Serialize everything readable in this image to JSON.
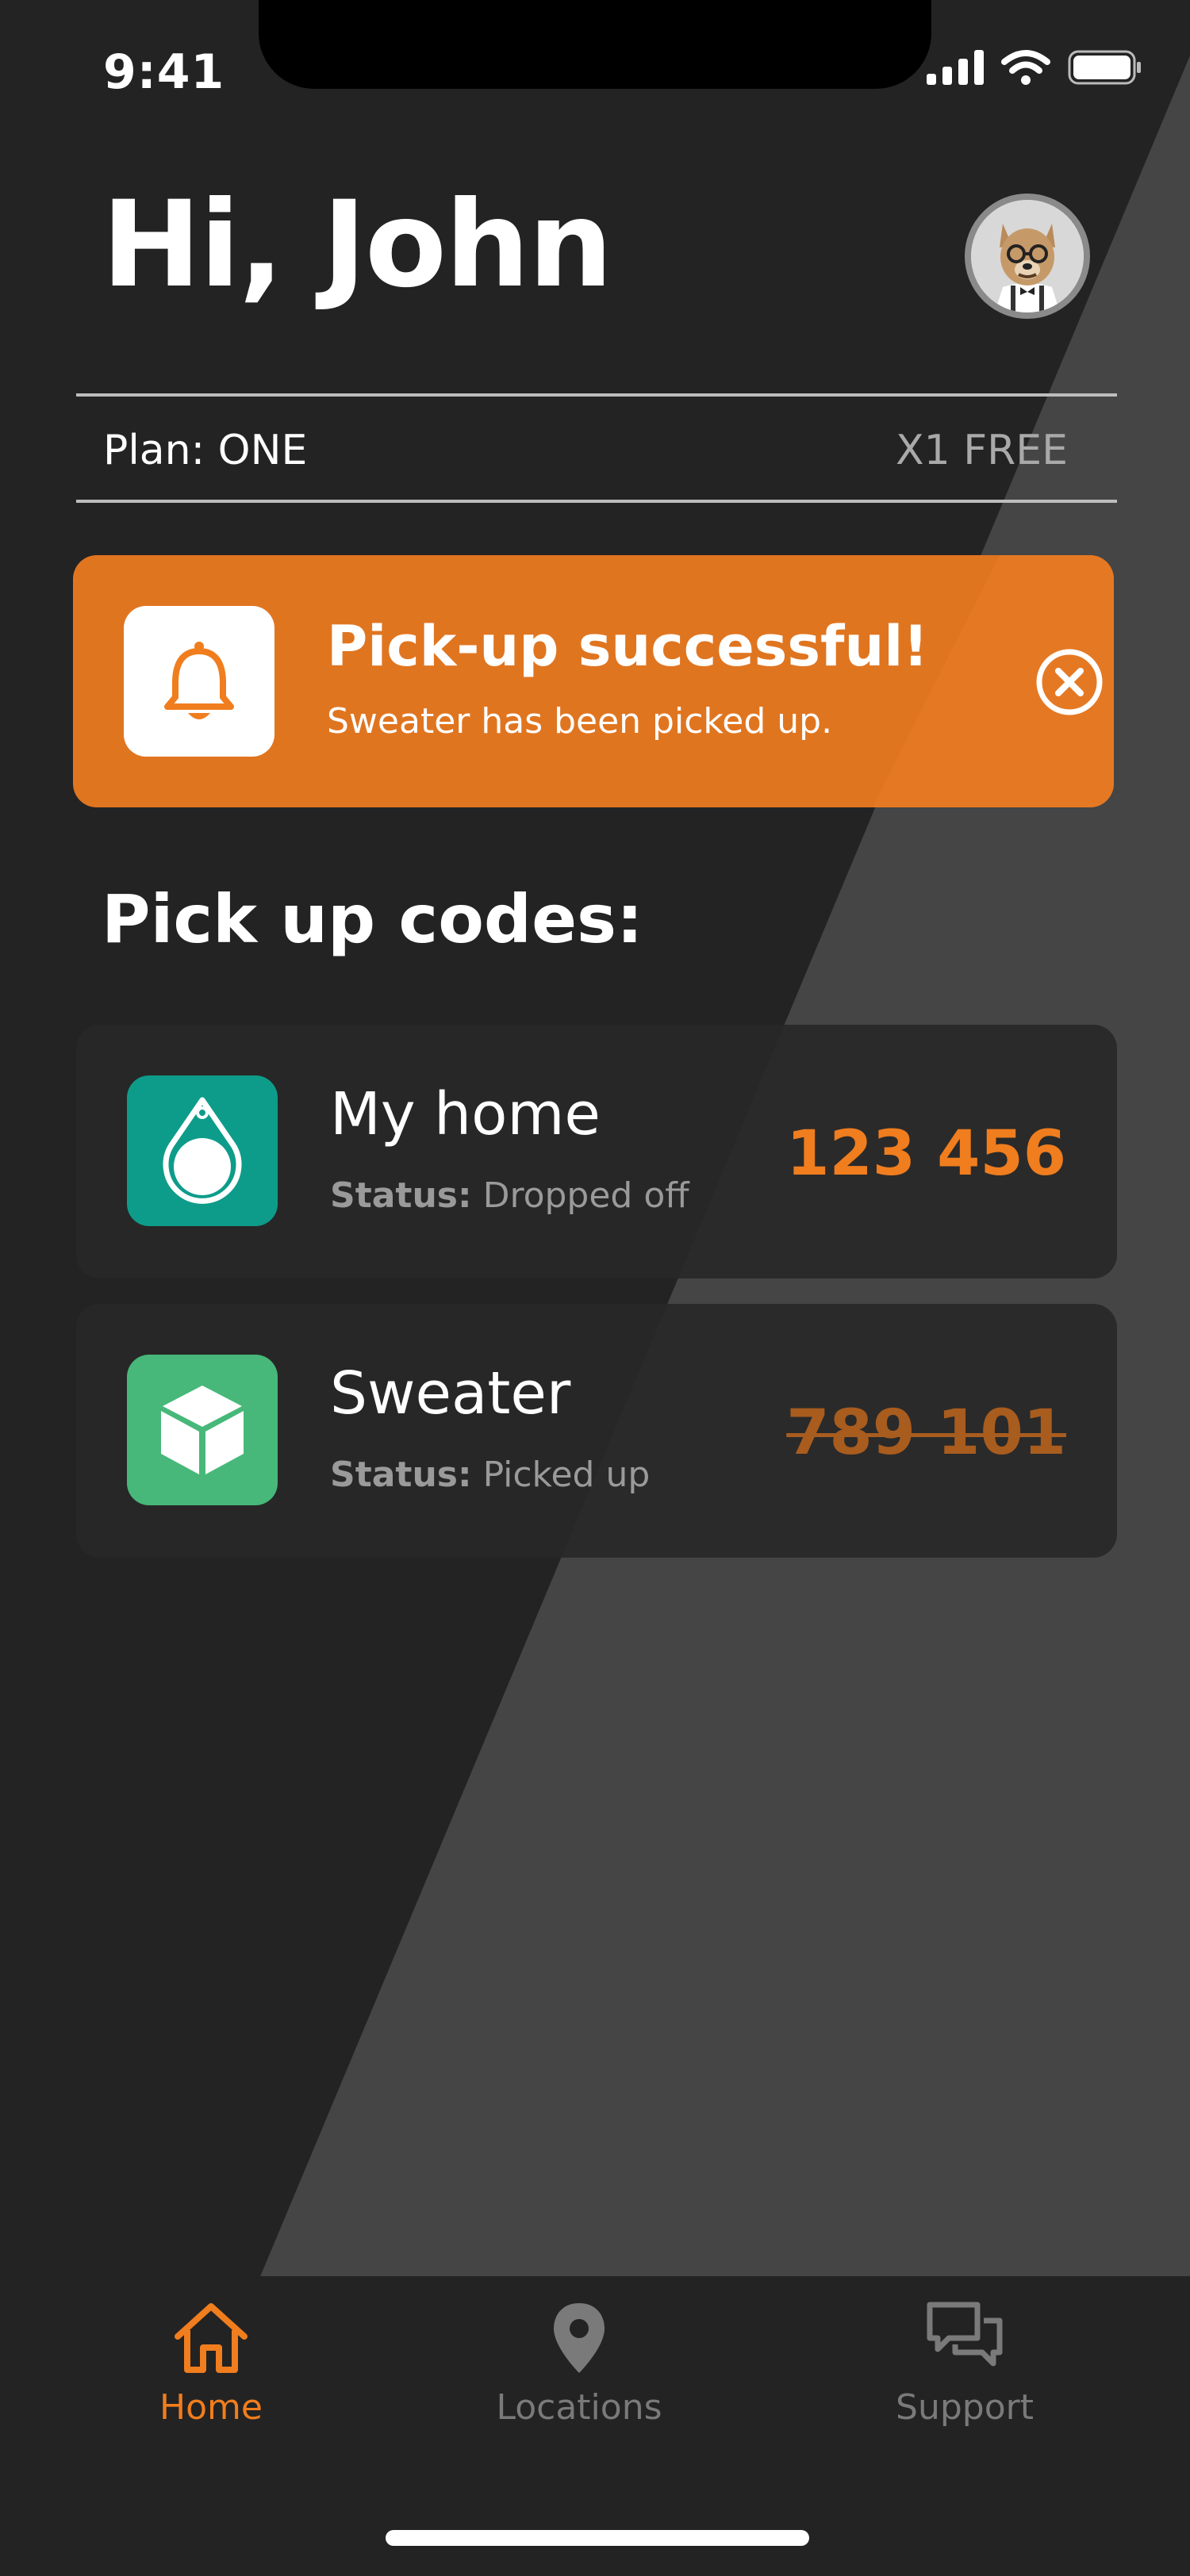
{
  "status_bar": {
    "time": "9:41"
  },
  "header": {
    "greeting": "Hi, John"
  },
  "plan": {
    "label": "Plan: ONE",
    "offer": "X1 FREE"
  },
  "alert": {
    "title": "Pick-up successful!",
    "message": "Sweater has been picked up.",
    "icon": "bell-icon"
  },
  "pickup": {
    "title": "Pick up codes:",
    "status_label": "Status:",
    "items": [
      {
        "name": "My home",
        "status": "Dropped off",
        "code": "123 456",
        "icon": "key-fob-icon",
        "color": "#0e9c8a"
      },
      {
        "name": "Sweater",
        "status": "Picked up",
        "code": "789 101",
        "icon": "box-icon",
        "color": "#47b87a"
      }
    ]
  },
  "tabs": [
    {
      "label": "Home",
      "icon": "home-icon",
      "active": true
    },
    {
      "label": "Locations",
      "icon": "location-pin-icon",
      "active": false
    },
    {
      "label": "Support",
      "icon": "chat-icon",
      "active": false
    }
  ],
  "colors": {
    "accent": "#f07d1e",
    "alert_bg": "#e07520",
    "background": "#232323"
  }
}
